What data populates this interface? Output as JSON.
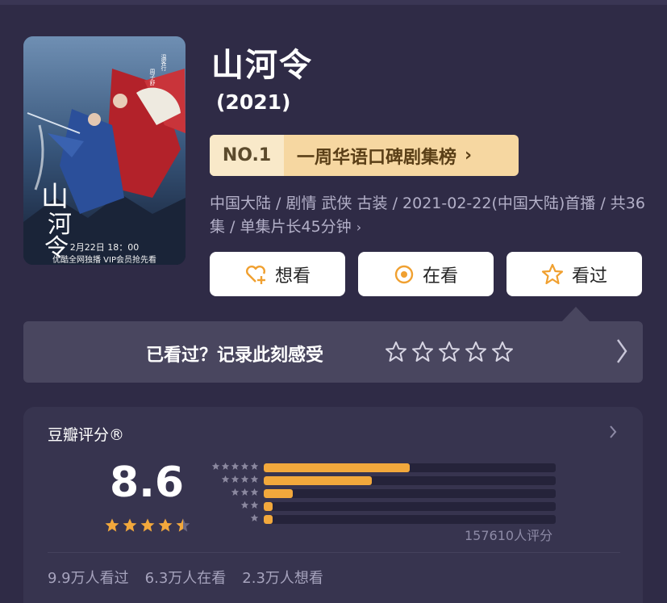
{
  "poster": {
    "title_art": "山河令",
    "credit_left": "周子舒",
    "credit_right": "温客行",
    "date": "2月22日 18：00",
    "tagline": "优酷全网独播 VIP会员抢先看"
  },
  "show": {
    "title": "山河令",
    "year": "(2021)",
    "meta": "中国大陆 / 剧情 武侠 古装 / 2021-02-22(中国大陆)首播 / 共36集 / 单集片长45分钟"
  },
  "rank": {
    "badge": "NO.1",
    "label": "一周华语口碑剧集榜"
  },
  "actions": [
    {
      "label": "想看",
      "icon": "heart-plus-icon"
    },
    {
      "label": "在看",
      "icon": "circle-dot-icon"
    },
    {
      "label": "看过",
      "icon": "star-outline-icon"
    }
  ],
  "record": {
    "prompt": "已看过？记录此刻感受",
    "star_count": 5
  },
  "rating": {
    "title": "豆瓣评分®",
    "score": "8.6",
    "score_stars": 4.5,
    "distribution": [
      {
        "stars": 5,
        "fraction": 0.5
      },
      {
        "stars": 4,
        "fraction": 0.37
      },
      {
        "stars": 3,
        "fraction": 0.1
      },
      {
        "stars": 2,
        "fraction": 0.03
      },
      {
        "stars": 1,
        "fraction": 0.03
      }
    ],
    "count": "157610人评分"
  },
  "stats": {
    "watched": "9.9万人看过",
    "watching": "6.3万人在看",
    "want": "2.3万人想看"
  },
  "colors": {
    "background": "#2f2b46",
    "accent": "#f2a83c",
    "rank_badge": "#f6d7a1",
    "button_icon": "#f0a030"
  }
}
